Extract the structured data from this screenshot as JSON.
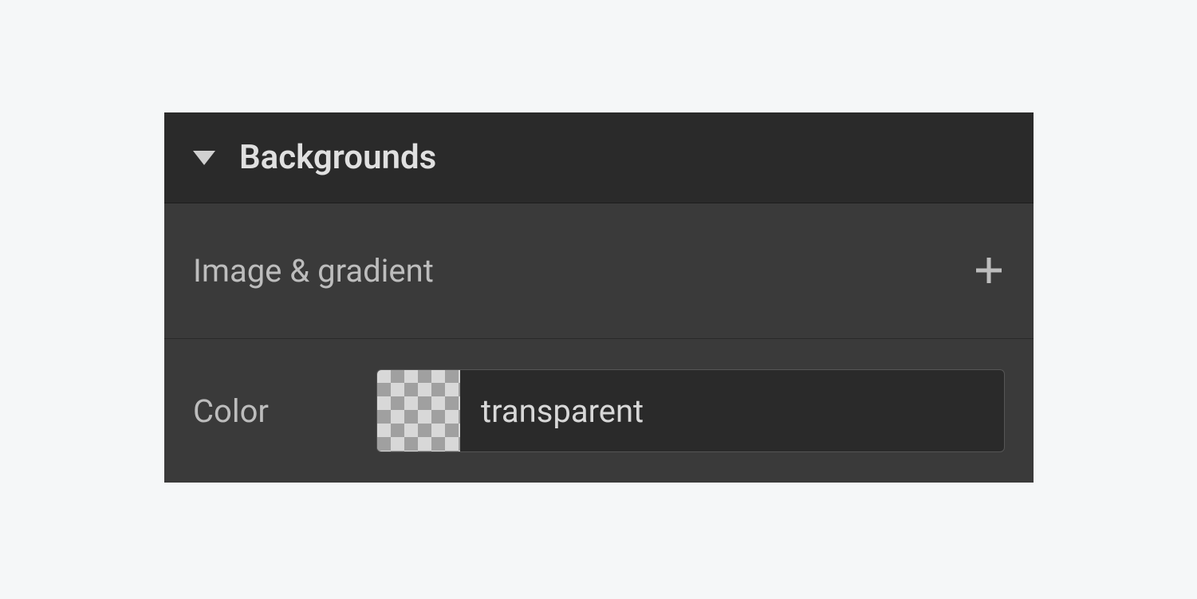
{
  "section": {
    "title": "Backgrounds"
  },
  "rows": {
    "image_gradient": {
      "label": "Image & gradient"
    },
    "color": {
      "label": "Color",
      "value": "transparent"
    }
  }
}
